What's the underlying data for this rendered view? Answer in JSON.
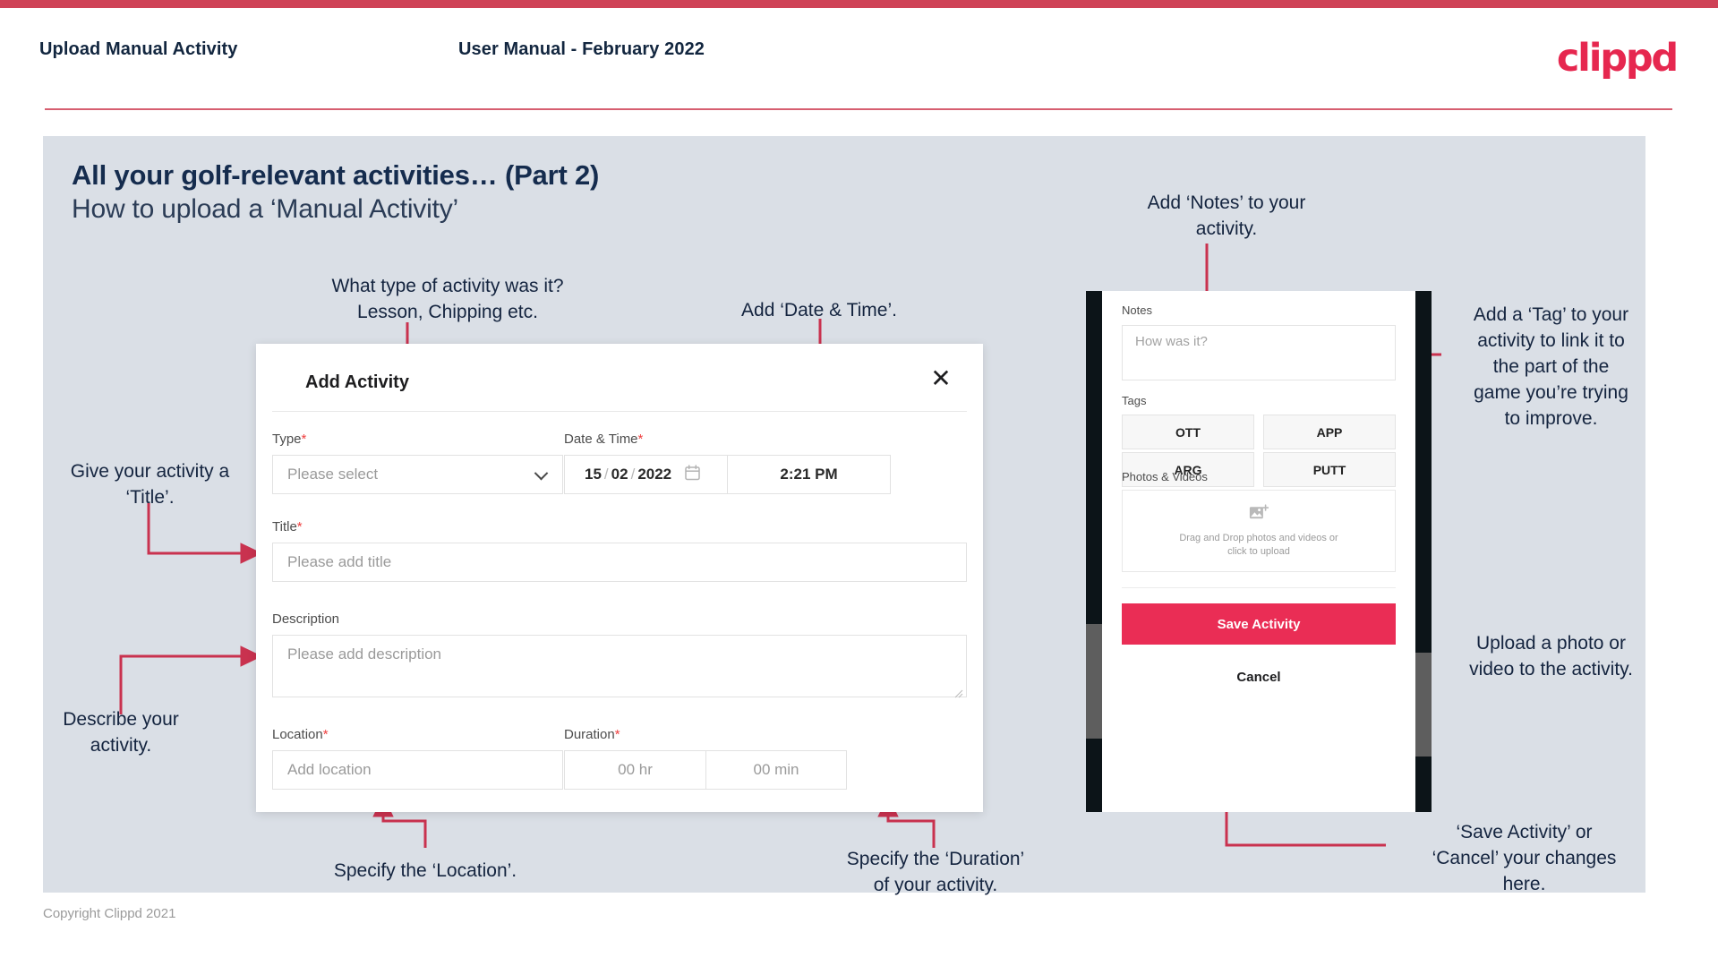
{
  "header": {
    "left_title": "Upload Manual Activity",
    "center_title": "User Manual - February 2022",
    "logo": "clippd"
  },
  "slide": {
    "title_line1": "All your golf-relevant activities… (Part 2)",
    "title_line2": "How to upload a ‘Manual Activity’"
  },
  "annotations": {
    "type": "What type of activity was it?\nLesson, Chipping etc.",
    "datetime": "Add ‘Date & Time’.",
    "title": "Give your activity a\n‘Title’.",
    "describe": "Describe your\nactivity.",
    "location": "Specify the ‘Location’.",
    "duration": "Specify the ‘Duration’\nof your activity.",
    "notes": "Add ‘Notes’ to your\nactivity.",
    "tag": "Add a ‘Tag’ to your\nactivity to link it to\nthe part of the\ngame you’re trying\nto improve.",
    "upload": "Upload a photo or\nvideo to the activity.",
    "save_cancel": "‘Save Activity’ or\n‘Cancel’ your changes\nhere."
  },
  "dialog": {
    "title": "Add Activity",
    "close_icon": "close-icon",
    "fields": {
      "type": {
        "label": "Type",
        "required": "*",
        "placeholder": "Please select",
        "chevron_icon": "chevron-down-icon"
      },
      "datetime": {
        "label": "Date & Time",
        "required": "*",
        "day": "15",
        "sep1": "/",
        "month": "02",
        "sep2": "/",
        "year": "2022",
        "calendar_icon": "calendar-icon",
        "time": "2:21 PM"
      },
      "title": {
        "label": "Title",
        "required": "*",
        "placeholder": "Please add title"
      },
      "description": {
        "label": "Description",
        "required": "",
        "placeholder": "Please add description"
      },
      "location": {
        "label": "Location",
        "required": "*",
        "placeholder": "Add location"
      },
      "duration": {
        "label": "Duration",
        "required": "*",
        "hours": "00 hr",
        "minutes": "00 min"
      }
    }
  },
  "phone": {
    "notes_label": "Notes",
    "notes_placeholder": "How was it?",
    "tags_label": "Tags",
    "tags": [
      "OTT",
      "APP",
      "ARG",
      "PUTT"
    ],
    "photos_label": "Photos & Videos",
    "dropzone_icon": "add-image-icon",
    "dropzone_text_line1": "Drag and Drop photos and videos or",
    "dropzone_text_line2": "click to upload",
    "save_label": "Save Activity",
    "cancel_label": "Cancel"
  },
  "footer": {
    "copyright": "Copyright Clippd 2021"
  },
  "colors": {
    "brand_pink": "#e6274f",
    "strip": "#cf4257",
    "save_button": "#ea2d55",
    "slide_bg": "#dadfe6",
    "heading": "#152c4e",
    "arrow": "#c9324f",
    "required": "#ef3e3e"
  }
}
